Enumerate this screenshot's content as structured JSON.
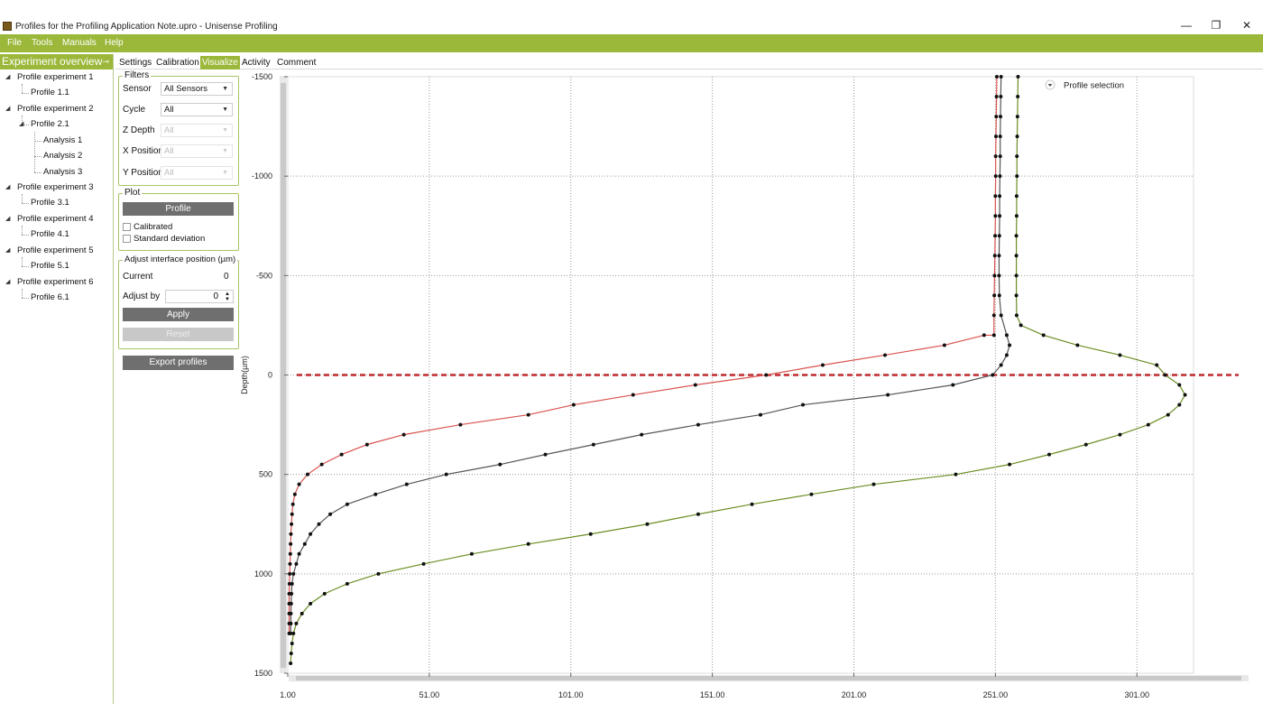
{
  "window": {
    "title": "Profiles for the Profiling Application Note.upro - Unisense Profiling",
    "minimize": "—",
    "restore": "❐",
    "close": "✕"
  },
  "menu": {
    "items": [
      "File",
      "Tools",
      "Manuals",
      "Help"
    ]
  },
  "experiment_overview": {
    "header": "Experiment overview",
    "pin_icon": "pin-icon",
    "tree": [
      {
        "label": "Profile experiment 1",
        "children": [
          {
            "label": "Profile 1.1"
          }
        ]
      },
      {
        "label": "Profile experiment 2",
        "children": [
          {
            "label": "Profile 2.1",
            "children": [
              "Analysis 1",
              "Analysis 2",
              "Analysis 3"
            ]
          }
        ]
      },
      {
        "label": "Profile experiment 3",
        "children": [
          {
            "label": "Profile 3.1"
          }
        ]
      },
      {
        "label": "Profile experiment 4",
        "children": [
          {
            "label": "Profile 4.1"
          }
        ]
      },
      {
        "label": "Profile experiment 5",
        "children": [
          {
            "label": "Profile 5.1"
          }
        ]
      },
      {
        "label": "Profile experiment 6",
        "children": [
          {
            "label": "Profile 6.1"
          }
        ]
      }
    ]
  },
  "tabs": [
    "Settings",
    "Calibration",
    "Visualize",
    "Activity",
    "Comment"
  ],
  "active_tab": "Visualize",
  "filters": {
    "title": "Filters",
    "sensor_label": "Sensor",
    "sensor_value": "All Sensors",
    "cycle_label": "Cycle",
    "cycle_value": "All",
    "z_label": "Z Depth",
    "z_value": "All",
    "x_label": "X Position",
    "x_value": "All",
    "y_label": "Y Position",
    "y_value": "All"
  },
  "plot": {
    "title": "Plot",
    "profile_button": "Profile",
    "calibrated_label": "Calibrated",
    "calibrated_checked": false,
    "stddev_label": "Standard deviation",
    "stddev_checked": false
  },
  "adjust": {
    "title": "Adjust interface position (µm)",
    "current_label": "Current",
    "current_value": "0",
    "adjust_label": "Adjust by",
    "adjust_value": "0",
    "apply_button": "Apply",
    "reset_button": "Reset"
  },
  "export_button": "Export profiles",
  "colors": {
    "accent": "#9bb83b",
    "series_red": "#d9534f",
    "series_gray": "#555555",
    "series_green": "#6b8e23",
    "interface_line": "#c0282d"
  },
  "chart_data": {
    "type": "line",
    "ylabel": "Depth(µm)",
    "xlabel": "",
    "xlim": [
      1,
      321
    ],
    "ylim": [
      -1500,
      1500
    ],
    "y_inverted": true,
    "x_ticks": [
      "1.00",
      "51.00",
      "101.00",
      "151.00",
      "201.00",
      "251.00",
      "301.00"
    ],
    "x_tick_values": [
      1,
      51,
      101,
      151,
      201,
      251,
      301
    ],
    "y_ticks": [
      "-1500",
      "-1000",
      "-500",
      "0",
      "500",
      "1000",
      "1500"
    ],
    "y_tick_values": [
      -1500,
      -1000,
      -500,
      0,
      500,
      1000,
      1500
    ],
    "grid": true,
    "interface_line_y": 0,
    "legend_label": "Profile selection",
    "legend_placement": "top-right",
    "series": [
      {
        "color": "#d9534f",
        "points": [
          [
            251.5,
            -1500
          ],
          [
            251.4,
            -1400
          ],
          [
            251.3,
            -1300
          ],
          [
            251.2,
            -1200
          ],
          [
            251.1,
            -1100
          ],
          [
            251.1,
            -1000
          ],
          [
            251.0,
            -900
          ],
          [
            251.0,
            -800
          ],
          [
            250.9,
            -700
          ],
          [
            250.8,
            -600
          ],
          [
            250.7,
            -500
          ],
          [
            250.6,
            -400
          ],
          [
            250.5,
            -300
          ],
          [
            250.5,
            -200
          ],
          [
            247.0,
            -200
          ],
          [
            233.0,
            -150
          ],
          [
            212.0,
            -100
          ],
          [
            190.0,
            -50
          ],
          [
            170.0,
            0
          ],
          [
            145.0,
            50
          ],
          [
            123.0,
            100
          ],
          [
            102.0,
            150
          ],
          [
            86.0,
            200
          ],
          [
            62.0,
            250
          ],
          [
            42.0,
            300
          ],
          [
            29.0,
            350
          ],
          [
            20.0,
            400
          ],
          [
            13.0,
            450
          ],
          [
            8.0,
            500
          ],
          [
            5.0,
            550
          ],
          [
            3.5,
            600
          ],
          [
            2.8,
            650
          ],
          [
            2.5,
            700
          ],
          [
            2.3,
            750
          ],
          [
            2.1,
            800
          ],
          [
            2.0,
            850
          ],
          [
            1.9,
            900
          ],
          [
            1.8,
            950
          ],
          [
            1.7,
            1000
          ],
          [
            1.6,
            1050
          ],
          [
            1.5,
            1100
          ],
          [
            1.5,
            1150
          ],
          [
            1.5,
            1200
          ],
          [
            1.5,
            1250
          ],
          [
            1.5,
            1300
          ]
        ]
      },
      {
        "color": "#555555",
        "points": [
          [
            253.0,
            -1500
          ],
          [
            252.9,
            -1400
          ],
          [
            252.8,
            -1300
          ],
          [
            252.7,
            -1200
          ],
          [
            252.7,
            -1100
          ],
          [
            252.6,
            -1000
          ],
          [
            252.5,
            -900
          ],
          [
            252.5,
            -800
          ],
          [
            252.4,
            -700
          ],
          [
            252.3,
            -600
          ],
          [
            252.3,
            -500
          ],
          [
            252.4,
            -400
          ],
          [
            253.0,
            -300
          ],
          [
            255.0,
            -200
          ],
          [
            256.0,
            -150
          ],
          [
            255.0,
            -100
          ],
          [
            253.0,
            -50
          ],
          [
            250.0,
            0
          ],
          [
            236.0,
            50
          ],
          [
            213.0,
            100
          ],
          [
            183.0,
            150
          ],
          [
            168.0,
            200
          ],
          [
            146.0,
            250
          ],
          [
            126.0,
            300
          ],
          [
            109.0,
            350
          ],
          [
            92.0,
            400
          ],
          [
            76.0,
            450
          ],
          [
            57.0,
            500
          ],
          [
            43.0,
            550
          ],
          [
            32.0,
            600
          ],
          [
            22.0,
            650
          ],
          [
            16.0,
            700
          ],
          [
            12.0,
            750
          ],
          [
            9.0,
            800
          ],
          [
            7.0,
            850
          ],
          [
            5.0,
            900
          ],
          [
            4.0,
            950
          ],
          [
            3.0,
            1000
          ],
          [
            2.5,
            1050
          ],
          [
            2.3,
            1100
          ],
          [
            2.2,
            1150
          ],
          [
            2.1,
            1200
          ],
          [
            2.1,
            1250
          ],
          [
            2.0,
            1300
          ]
        ]
      },
      {
        "color": "#6b8e23",
        "points": [
          [
            259.0,
            -1500
          ],
          [
            258.9,
            -1400
          ],
          [
            258.8,
            -1300
          ],
          [
            258.7,
            -1200
          ],
          [
            258.6,
            -1100
          ],
          [
            258.6,
            -1000
          ],
          [
            258.5,
            -900
          ],
          [
            258.5,
            -800
          ],
          [
            258.4,
            -700
          ],
          [
            258.4,
            -600
          ],
          [
            258.4,
            -500
          ],
          [
            258.4,
            -400
          ],
          [
            258.5,
            -300
          ],
          [
            260.0,
            -250
          ],
          [
            268.0,
            -200
          ],
          [
            280.0,
            -150
          ],
          [
            295.0,
            -100
          ],
          [
            308.0,
            -50
          ],
          [
            311.0,
            0
          ],
          [
            316.0,
            50
          ],
          [
            318.0,
            100
          ],
          [
            316.0,
            150
          ],
          [
            312.0,
            200
          ],
          [
            305.0,
            250
          ],
          [
            295.0,
            300
          ],
          [
            283.0,
            350
          ],
          [
            270.0,
            400
          ],
          [
            256.0,
            450
          ],
          [
            237.0,
            500
          ],
          [
            208.0,
            550
          ],
          [
            186.0,
            600
          ],
          [
            165.0,
            650
          ],
          [
            146.0,
            700
          ],
          [
            128.0,
            750
          ],
          [
            108.0,
            800
          ],
          [
            86.0,
            850
          ],
          [
            66.0,
            900
          ],
          [
            49.0,
            950
          ],
          [
            33.0,
            1000
          ],
          [
            22.0,
            1050
          ],
          [
            14.0,
            1100
          ],
          [
            9.0,
            1150
          ],
          [
            6.0,
            1200
          ],
          [
            4.0,
            1250
          ],
          [
            3.0,
            1300
          ],
          [
            2.5,
            1350
          ],
          [
            2.2,
            1400
          ],
          [
            2.0,
            1450
          ]
        ]
      }
    ]
  }
}
